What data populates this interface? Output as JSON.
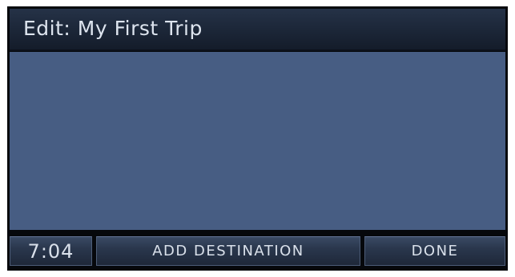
{
  "header": {
    "title": "Edit: My First Trip"
  },
  "bottom_bar": {
    "clock": "7:04",
    "add_destination_label": "ADD DESTINATION",
    "done_label": "DONE"
  },
  "colors": {
    "content_background": "#475d83",
    "title_bar": "#1d283a",
    "button_face": "#2a374d",
    "text": "#dde4ee"
  }
}
